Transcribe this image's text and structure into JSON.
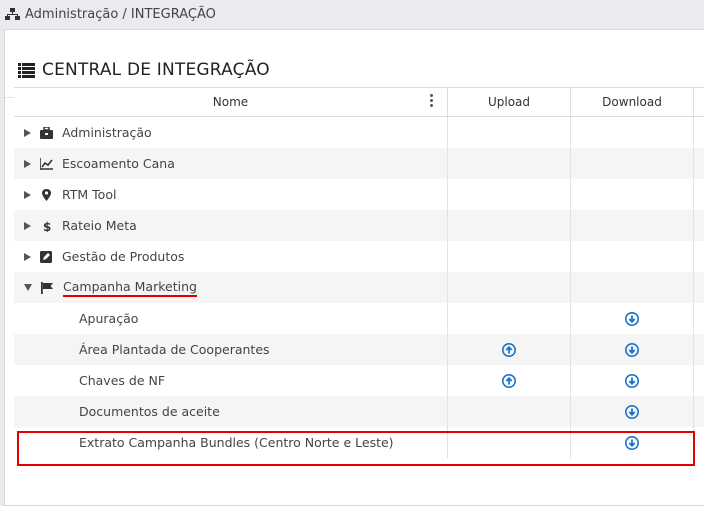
{
  "breadcrumb": {
    "text": "Administração / INTEGRAÇÃO",
    "icon": "sitemap-icon"
  },
  "panel": {
    "title": "CENTRAL DE INTEGRAÇÃO",
    "icon": "list-icon"
  },
  "table": {
    "headers": {
      "name": "Nome",
      "upload": "Upload",
      "download": "Download"
    },
    "groups": [
      {
        "label": "Administração",
        "icon": "briefcase-icon",
        "expanded": false
      },
      {
        "label": "Escoamento Cana",
        "icon": "line-chart-icon",
        "expanded": false
      },
      {
        "label": "RTM Tool",
        "icon": "map-marker-icon",
        "expanded": false
      },
      {
        "label": "Rateio Meta",
        "icon": "dollar-icon",
        "expanded": false
      },
      {
        "label": "Gestão de Produtos",
        "icon": "edit-icon",
        "expanded": false
      },
      {
        "label": "Campanha Marketing",
        "icon": "flag-icon",
        "expanded": true
      }
    ],
    "children": [
      {
        "label": "Apuração",
        "upload": false,
        "download": true
      },
      {
        "label": "Área Plantada de Cooperantes",
        "upload": true,
        "download": true
      },
      {
        "label": "Chaves de NF",
        "upload": true,
        "download": true
      },
      {
        "label": "Documentos de aceite",
        "upload": false,
        "download": true,
        "highlighted": true
      },
      {
        "label": "Extrato Campanha Bundles (Centro Norte e Leste)",
        "upload": false,
        "download": true
      }
    ]
  },
  "colors": {
    "accent": "#1a73c9",
    "highlight": "#e60000",
    "text": "#444444"
  }
}
